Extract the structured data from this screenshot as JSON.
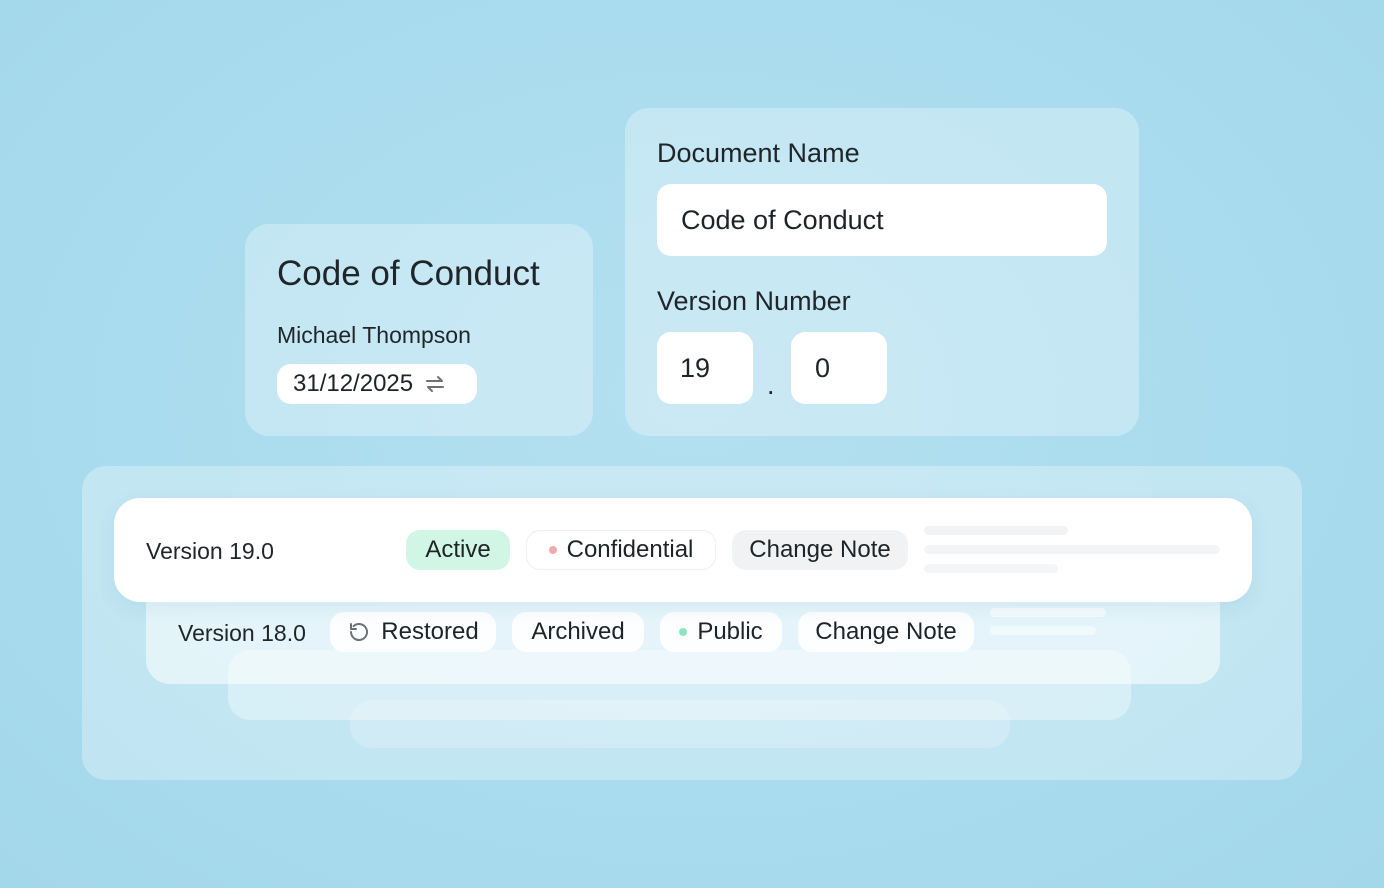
{
  "doc_card": {
    "title": "Code of Conduct",
    "author": "Michael Thompson",
    "date": "31/12/2025",
    "date_icon": "swap-arrows-icon"
  },
  "form": {
    "name_label": "Document Name",
    "name_value": "Code of Conduct",
    "version_label": "Version Number",
    "version_major": "19",
    "version_separator": ".",
    "version_minor": "0"
  },
  "versions": {
    "current": {
      "label": "Version 19.0",
      "status": "Active",
      "visibility": "Confidential",
      "note_button": "Change Note"
    },
    "previous": {
      "label": "Version 18.0",
      "restored": "Restored",
      "restored_icon": "restore-icon",
      "archived": "Archived",
      "visibility": "Public",
      "note_button": "Change Note"
    }
  },
  "colors": {
    "background": "#a9dcee",
    "active_chip": "#d2f6e6",
    "confidential_dot": "#f3a9a9",
    "public_dot": "#8fe3bd",
    "change_note_chip": "#f1f2f3"
  }
}
